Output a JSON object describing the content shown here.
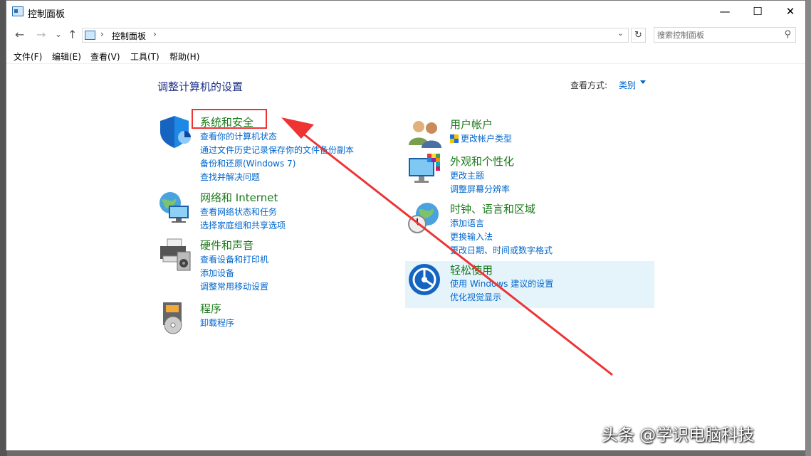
{
  "window": {
    "title": "控制面板",
    "minimize": "—",
    "maximize": "☐",
    "close": "✕"
  },
  "address": {
    "back": "←",
    "forward": "→",
    "recent": "⌄",
    "up": "↑",
    "sep1": "›",
    "crumb": "控制面板",
    "sep2": "›",
    "dropdown": "⌄",
    "refresh": "↻",
    "search_placeholder": "搜索控制面板",
    "search_icon": "⚲"
  },
  "menu": [
    "文件(F)",
    "编辑(E)",
    "查看(V)",
    "工具(T)",
    "帮助(H)"
  ],
  "page": {
    "title": "调整计算机的设置",
    "view_label": "查看方式:",
    "view_value": "类别"
  },
  "categories_left": [
    {
      "title": "系统和安全",
      "icon": "shield-icon",
      "links": [
        "查看你的计算机状态",
        "通过文件历史记录保存你的文件备份副本",
        "备份和还原(Windows 7)",
        "查找并解决问题"
      ]
    },
    {
      "title": "网络和 Internet",
      "icon": "network-globe-icon",
      "links": [
        "查看网络状态和任务",
        "选择家庭组和共享选项"
      ]
    },
    {
      "title": "硬件和声音",
      "icon": "printer-speaker-icon",
      "links": [
        "查看设备和打印机",
        "添加设备",
        "调整常用移动设置"
      ]
    },
    {
      "title": "程序",
      "icon": "programs-disc-icon",
      "links": [
        "卸载程序"
      ]
    }
  ],
  "categories_right": [
    {
      "title": "用户帐户",
      "icon": "users-icon",
      "links": [
        "更改帐户类型"
      ]
    },
    {
      "title": "外观和个性化",
      "icon": "monitor-palette-icon",
      "links": [
        "更改主题",
        "调整屏幕分辨率"
      ]
    },
    {
      "title": "时钟、语言和区域",
      "icon": "clock-globe-icon",
      "links": [
        "添加语言",
        "更换输入法",
        "更改日期、时间或数字格式"
      ]
    },
    {
      "title": "轻松使用",
      "icon": "ease-of-access-icon",
      "links": [
        "使用 Windows 建议的设置",
        "优化视觉显示"
      ]
    }
  ],
  "watermark": "头条 @学识电脑科技",
  "colors": {
    "category_title": "#1a7a1a",
    "link": "#0066cc",
    "page_title": "#1e3287",
    "annotation_red": "#ee3333",
    "hover_highlight": "#e5f3fb"
  }
}
